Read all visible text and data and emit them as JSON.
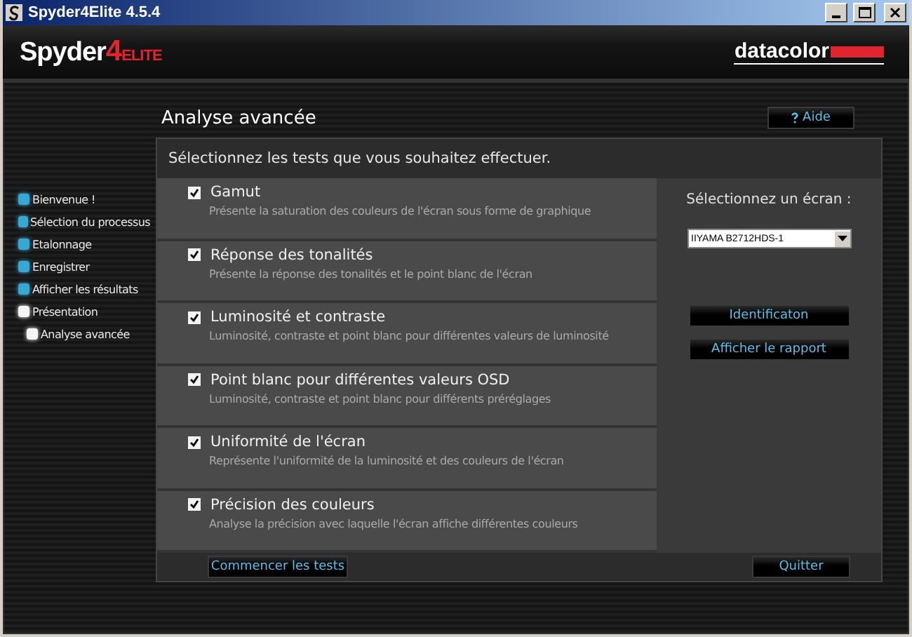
{
  "window": {
    "title": "Spyder4Elite 4.5.4"
  },
  "header": {
    "logo": {
      "name": "Spyder",
      "number": "4",
      "edition": "ELITE"
    },
    "brand": "datacolor"
  },
  "sidebar": {
    "items": [
      {
        "label": "Bienvenue !",
        "current": false
      },
      {
        "label": "Sélection du processus",
        "current": false
      },
      {
        "label": "Etalonnage",
        "current": false
      },
      {
        "label": "Enregistrer",
        "current": false
      },
      {
        "label": "Afficher les résultats",
        "current": false
      },
      {
        "label": "Présentation",
        "current": true,
        "children": [
          {
            "label": "Analyse avancée",
            "current": true
          }
        ]
      }
    ]
  },
  "page": {
    "title": "Analyse avancée",
    "help_button": "Aide",
    "instruction": "Sélectionnez les tests que vous souhaitez effectuer."
  },
  "tests": [
    {
      "title": "Gamut",
      "description": "Présente la saturation des couleurs de l'écran sous forme de graphique",
      "checked": true
    },
    {
      "title": "Réponse des tonalités",
      "description": "Présente la réponse des tonalités et le point blanc de l'écran",
      "checked": true
    },
    {
      "title": "Luminosité et contraste",
      "description": "Luminosité, contraste et point blanc pour différentes valeurs de luminosité",
      "checked": true
    },
    {
      "title": "Point blanc pour différentes valeurs OSD",
      "description": "Luminosité, contraste et point blanc pour différents préréglages",
      "checked": true
    },
    {
      "title": "Uniformité de l'écran",
      "description": "Représente l'uniformité de la luminosité et des couleurs de l'écran",
      "checked": true
    },
    {
      "title": "Précision des couleurs",
      "description": "Analyse la précision avec laquelle l'écran affiche différentes couleurs",
      "checked": true
    }
  ],
  "display_panel": {
    "label": "Sélectionnez un écran :",
    "display_select": "IIYAMA B2712HDS-1",
    "buttons": [
      "Identificaton",
      "Afficher le rapport"
    ]
  },
  "footer": {
    "start_button": "Commencer les tests",
    "quit_button": "Quitter"
  }
}
